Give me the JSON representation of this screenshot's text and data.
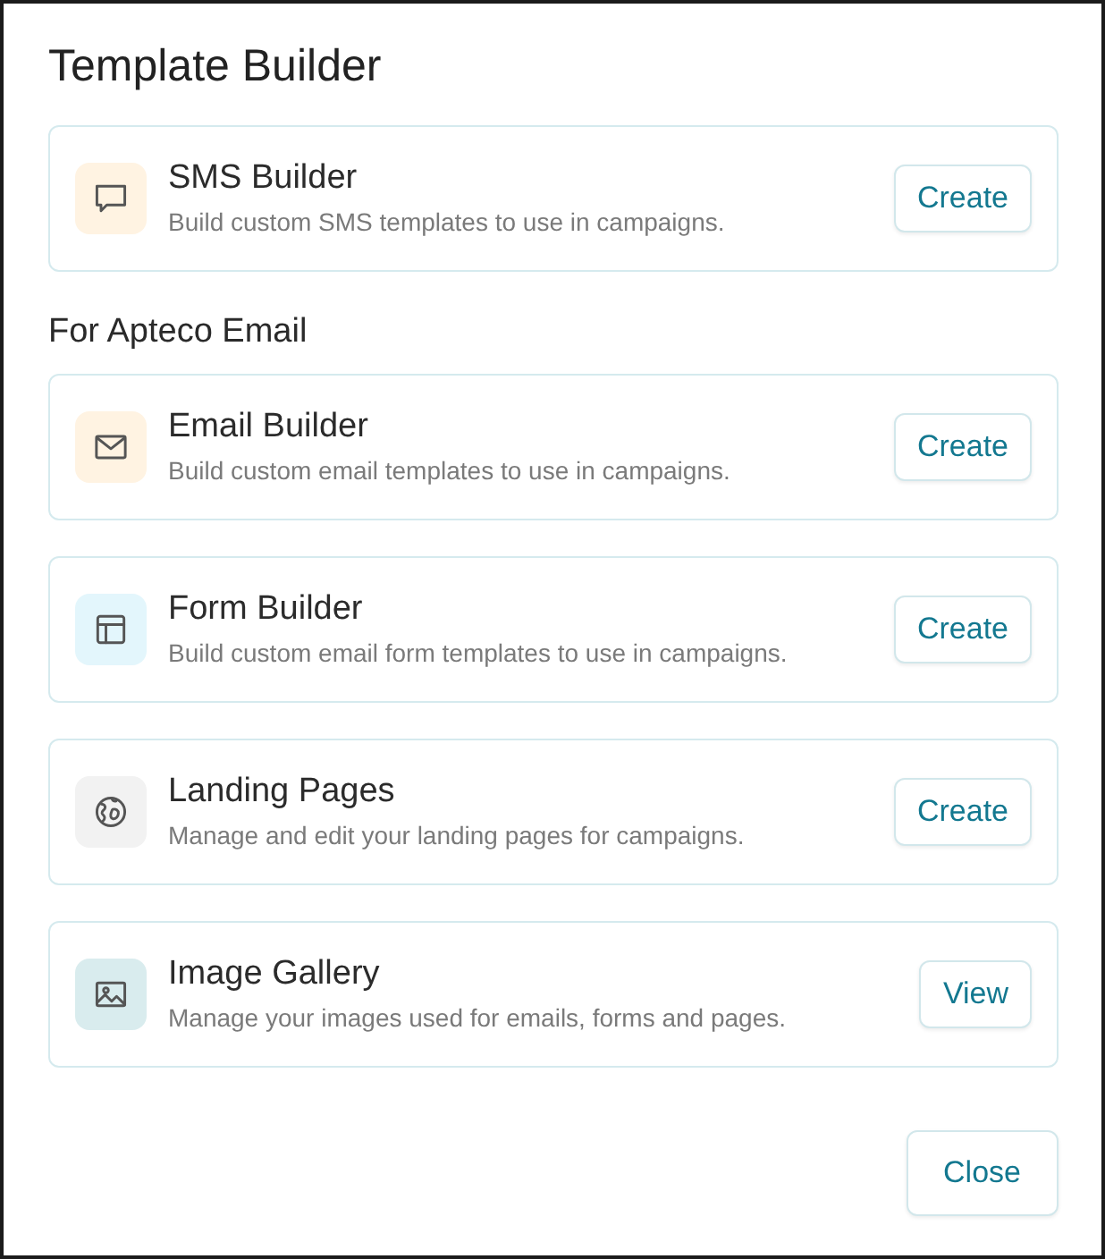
{
  "dialog": {
    "title": "Template Builder"
  },
  "builders": [
    {
      "title": "SMS Builder",
      "description": "Build custom SMS templates to use in campaigns.",
      "color": "#fff3e2",
      "button": "Create"
    }
  ],
  "section": {
    "heading": "For Apteco Email"
  },
  "email_tools": [
    {
      "title": "Email Builder",
      "description": "Build custom email templates to use in campaigns.",
      "color": "#fff3e2",
      "button": "Create"
    },
    {
      "title": "Form Builder",
      "description": "Build custom email form templates to use in campaigns.",
      "color": "#e3f6fc",
      "button": "Create"
    },
    {
      "title": "Landing Pages",
      "description": "Manage and edit your landing pages for campaigns.",
      "color": "#f2f2f2",
      "button": "Create"
    },
    {
      "title": "Image Gallery",
      "description": "Manage your images used for emails, forms and pages.",
      "color": "#d9ecee",
      "button": "View"
    }
  ],
  "footer": {
    "close_button": "Close"
  }
}
